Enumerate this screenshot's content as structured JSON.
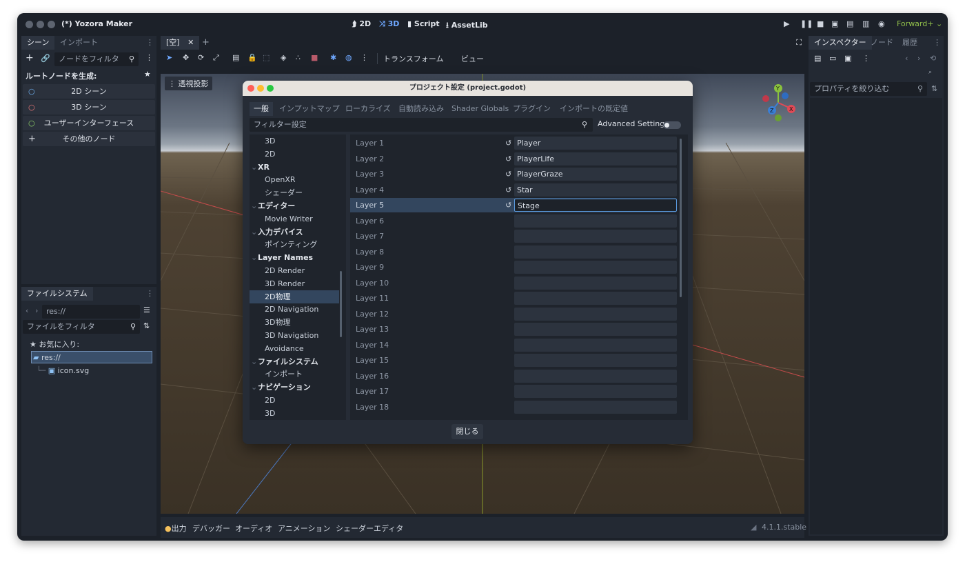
{
  "window": {
    "title": "(*) Yozora Maker"
  },
  "modes": [
    {
      "label": "2D",
      "icon": "2d-icon"
    },
    {
      "label": "3D",
      "icon": "3d-icon"
    },
    {
      "label": "Script",
      "icon": "script-icon"
    },
    {
      "label": "AssetLib",
      "icon": "assetlib-icon"
    }
  ],
  "renderer": "Forward+ ⌄",
  "scene_dock": {
    "tabs": [
      "シーン",
      "インポート"
    ],
    "filter_placeholder": "ノードをフィルタ",
    "create_root_label": "ルートノードを生成:",
    "buttons": [
      "2D シーン",
      "3D シーン",
      "ユーザーインターフェース",
      "その他のノード"
    ],
    "button_colors": [
      "#6fb2f2",
      "#f27a7a",
      "#8fd46a",
      "#dfe3ea"
    ]
  },
  "filesystem_dock": {
    "tab": "ファイルシステム",
    "path": "res://",
    "filter_placeholder": "ファイルをフィルタ",
    "favorites": "お気に入り:",
    "root": "res://",
    "files": [
      "icon.svg"
    ]
  },
  "editor_tabs": {
    "scene_tab": "[空]",
    "close": "✕",
    "add": "+"
  },
  "viewport_toolbar": {
    "transform": "トランスフォーム",
    "view": "ビュー",
    "perspective": "透視投影"
  },
  "gizmo": {
    "x": "X",
    "y": "Y",
    "z": "Z"
  },
  "inspector": {
    "tabs": [
      "インスペクター",
      "ノード",
      "履歴"
    ],
    "filter_placeholder": "プロパティを絞り込む"
  },
  "bottom_panel": {
    "items": [
      "出力",
      "デバッガー",
      "オーディオ",
      "アニメーション",
      "シェーダーエディタ"
    ],
    "version": "4.1.1.stable"
  },
  "dialog": {
    "title": "プロジェクト設定 (project.godot)",
    "tabs": [
      "一般",
      "インプットマップ",
      "ローカライズ",
      "自動読み込み",
      "Shader Globals",
      "プラグイン",
      "インポートの既定値"
    ],
    "filter_placeholder": "フィルター設定",
    "advanced_label": "Advanced Settings",
    "advanced_on": false,
    "tree": [
      {
        "label": "3D",
        "bold": false,
        "indent": 1
      },
      {
        "label": "2D",
        "bold": false,
        "indent": 1
      },
      {
        "label": "XR",
        "bold": true,
        "indent": 0
      },
      {
        "label": "OpenXR",
        "bold": false,
        "indent": 1
      },
      {
        "label": "シェーダー",
        "bold": false,
        "indent": 1
      },
      {
        "label": "エディター",
        "bold": true,
        "indent": 0
      },
      {
        "label": "Movie Writer",
        "bold": false,
        "indent": 1
      },
      {
        "label": "入力デバイス",
        "bold": true,
        "indent": 0
      },
      {
        "label": "ポインティング",
        "bold": false,
        "indent": 1
      },
      {
        "label": "Layer Names",
        "bold": true,
        "indent": 0
      },
      {
        "label": "2D Render",
        "bold": false,
        "indent": 1
      },
      {
        "label": "3D Render",
        "bold": false,
        "indent": 1
      },
      {
        "label": "2D物理",
        "bold": false,
        "indent": 1,
        "selected": true
      },
      {
        "label": "2D Navigation",
        "bold": false,
        "indent": 1
      },
      {
        "label": "3D物理",
        "bold": false,
        "indent": 1
      },
      {
        "label": "3D Navigation",
        "bold": false,
        "indent": 1
      },
      {
        "label": "Avoidance",
        "bold": false,
        "indent": 1
      },
      {
        "label": "ファイルシステム",
        "bold": true,
        "indent": 0
      },
      {
        "label": "インポート",
        "bold": false,
        "indent": 1
      },
      {
        "label": "ナビゲーション",
        "bold": true,
        "indent": 0
      },
      {
        "label": "2D",
        "bold": false,
        "indent": 1
      },
      {
        "label": "3D",
        "bold": false,
        "indent": 1
      }
    ],
    "layers": [
      {
        "label": "Layer 1",
        "value": "Player"
      },
      {
        "label": "Layer 2",
        "value": "PlayerLife"
      },
      {
        "label": "Layer 3",
        "value": "PlayerGraze"
      },
      {
        "label": "Layer 4",
        "value": "Star"
      },
      {
        "label": "Layer 5",
        "value": "Stage",
        "selected": true
      },
      {
        "label": "Layer 6",
        "value": ""
      },
      {
        "label": "Layer 7",
        "value": ""
      },
      {
        "label": "Layer 8",
        "value": ""
      },
      {
        "label": "Layer 9",
        "value": ""
      },
      {
        "label": "Layer 10",
        "value": ""
      },
      {
        "label": "Layer 11",
        "value": ""
      },
      {
        "label": "Layer 12",
        "value": ""
      },
      {
        "label": "Layer 13",
        "value": ""
      },
      {
        "label": "Layer 14",
        "value": ""
      },
      {
        "label": "Layer 15",
        "value": ""
      },
      {
        "label": "Layer 16",
        "value": ""
      },
      {
        "label": "Layer 17",
        "value": ""
      },
      {
        "label": "Layer 18",
        "value": ""
      }
    ],
    "revert_icon": "↺",
    "close_label": "閉じる"
  }
}
